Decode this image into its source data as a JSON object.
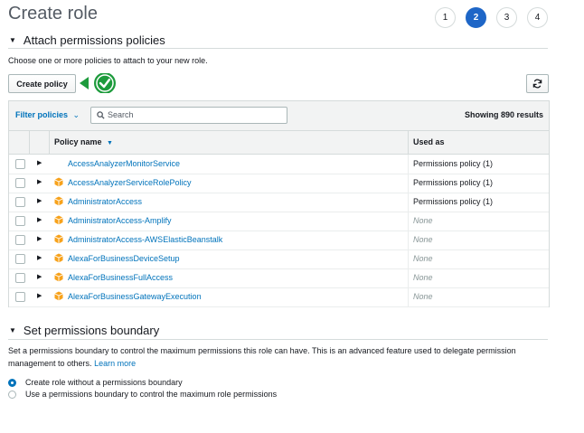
{
  "page": {
    "title": "Create role"
  },
  "steps": [
    {
      "label": "1",
      "active": false
    },
    {
      "label": "2",
      "active": true
    },
    {
      "label": "3",
      "active": false
    },
    {
      "label": "4",
      "active": false
    }
  ],
  "attach": {
    "heading": "Attach permissions policies",
    "description": "Choose one or more policies to attach to your new role.",
    "create_policy_label": "Create policy",
    "refresh_icon": "refresh-icon",
    "callout_icon": "green-check-icon",
    "accent_color": "#1d9b3c"
  },
  "filter": {
    "label": "Filter policies",
    "search_placeholder": "Search",
    "search_value": "",
    "showing": "Showing 890 results"
  },
  "table": {
    "columns": {
      "name": "Policy name",
      "used": "Used as"
    },
    "rows": [
      {
        "name": "AccessAnalyzerMonitorService",
        "used": "Permissions policy (1)",
        "icon": false
      },
      {
        "name": "AccessAnalyzerServiceRolePolicy",
        "used": "Permissions policy (1)",
        "icon": true
      },
      {
        "name": "AdministratorAccess",
        "used": "Permissions policy (1)",
        "icon": true
      },
      {
        "name": "AdministratorAccess-Amplify",
        "used": "None",
        "icon": true
      },
      {
        "name": "AdministratorAccess-AWSElasticBeanstalk",
        "used": "None",
        "icon": true
      },
      {
        "name": "AlexaForBusinessDeviceSetup",
        "used": "None",
        "icon": true
      },
      {
        "name": "AlexaForBusinessFullAccess",
        "used": "None",
        "icon": true
      },
      {
        "name": "AlexaForBusinessGatewayExecution",
        "used": "None",
        "icon": true
      }
    ]
  },
  "boundary": {
    "heading": "Set permissions boundary",
    "description": "Set a permissions boundary to control the maximum permissions this role can have. This is an advanced feature used to delegate permission management to others.",
    "learn_more": "Learn more",
    "options": [
      {
        "label": "Create role without a permissions boundary",
        "selected": true
      },
      {
        "label": "Use a permissions boundary to control the maximum role permissions",
        "selected": false
      }
    ]
  }
}
